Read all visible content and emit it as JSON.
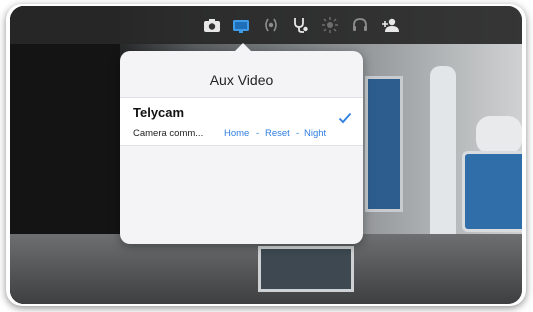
{
  "toolbar": {
    "icons": [
      "camera-icon",
      "aux-video-icon",
      "audio-icon",
      "stethoscope-icon",
      "brightness-icon",
      "headset-icon",
      "add-person-icon"
    ],
    "active": "aux-video-icon",
    "active_color": "#3d9be9"
  },
  "popover": {
    "title": "Aux Video",
    "sources": [
      {
        "name": "Telycam",
        "selected": true,
        "camera_label": "Camera comm...",
        "commands": [
          "Home",
          "Reset",
          "Night"
        ],
        "separator": "-"
      }
    ]
  },
  "colors": {
    "link": "#2f7ee0",
    "popover_bg": "#f4f4f6",
    "toolbar_bg": "#282828"
  }
}
